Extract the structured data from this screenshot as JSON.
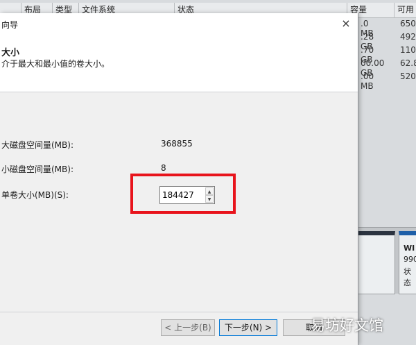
{
  "background": {
    "columns": [
      "布局",
      "类型",
      "文件系统",
      "状态",
      "容量",
      "可用"
    ],
    "rows": [
      {
        "capacity": ".0 MB",
        "free": "650"
      },
      {
        "capacity": ".28 GB",
        "free": "492"
      },
      {
        "capacity": ".70 GB",
        "free": "110"
      },
      {
        "capacity": "00.00 GB",
        "free": "62.8"
      },
      {
        "capacity": ".00 MB",
        "free": "520"
      }
    ],
    "disk_b_lines": [
      "WI",
      "990",
      "状态"
    ]
  },
  "dialog": {
    "title": "向导",
    "close_glyph": "×",
    "header_title": "大小",
    "header_desc": "介于最大和最小值的卷大小。",
    "fields": {
      "max_label": "大磁盘空间量(MB):",
      "max_value": "368855",
      "min_label": "小磁盘空间量(MB):",
      "min_value": "8",
      "size_label": "单卷大小(MB)(S):",
      "size_value": "184427"
    },
    "buttons": {
      "back": "< 上一步(B)",
      "next": "下一步(N) >",
      "cancel": "取消"
    }
  },
  "watermark": "易坊好文馆",
  "colors": {
    "highlight": "#e8141c",
    "disk_b_stripe": "#1e5fa8"
  }
}
